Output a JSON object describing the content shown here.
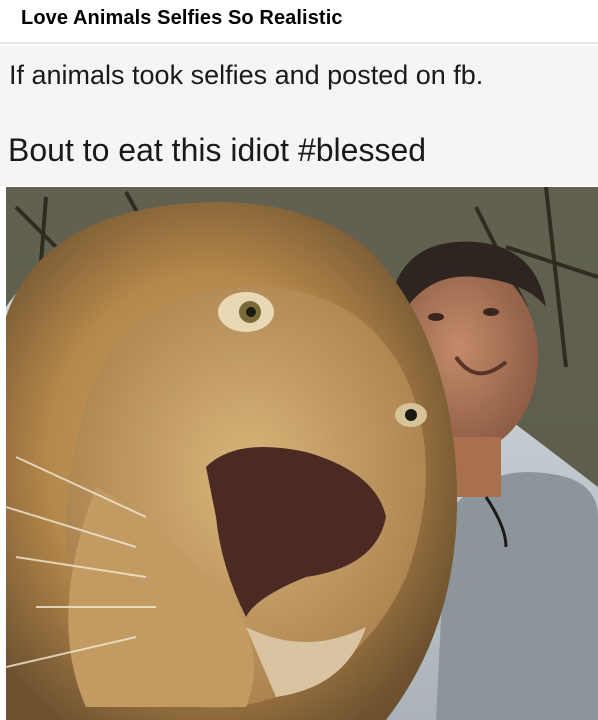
{
  "header": {
    "title": "Love Animals Selfies So Realistic"
  },
  "post": {
    "line1": "If animals took selfies and posted on fb.",
    "line2": "Bout to eat this idiot #blessed"
  },
  "photo": {
    "subject": "lion-selfie-with-man",
    "colors": {
      "sky": "#c9d4dc",
      "foliage": "#4a4a36",
      "mane": "#b88a4a",
      "face": "#c9a46a",
      "nose": "#4a2a22",
      "skin": "#b07a5c",
      "shirt": "#8c959a"
    }
  }
}
